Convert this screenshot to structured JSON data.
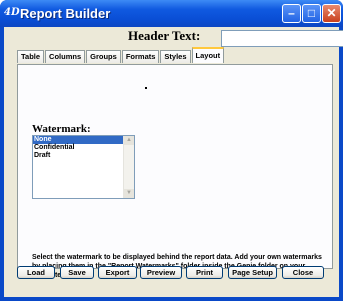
{
  "window": {
    "title": "Report Builder",
    "icon_text": "4D",
    "controls": {
      "minimize": "–",
      "maximize": "□",
      "close": "✕"
    }
  },
  "header": {
    "label": "Header Text:",
    "value": ""
  },
  "tabs": [
    {
      "label": "Table",
      "active": false
    },
    {
      "label": "Columns",
      "active": false
    },
    {
      "label": "Groups",
      "active": false
    },
    {
      "label": "Formats",
      "active": false
    },
    {
      "label": "Styles",
      "active": false
    },
    {
      "label": "Layout",
      "active": true
    }
  ],
  "watermark": {
    "label": "Watermark:",
    "options": [
      "None",
      "Confidential",
      "Draft"
    ],
    "selected": "None",
    "scroll_up": "▲",
    "scroll_down": "▼"
  },
  "help_text": "Select the watermark to be displayed behind the report data. Add your own watermarks by placing them in the \"Report Watermarks\" folder inside the Genie folder on your computer.",
  "buttons": {
    "load": "Load",
    "save": "Save",
    "export": "Export",
    "preview": "Preview",
    "print": "Print",
    "page_setup": "Page Setup",
    "close": "Close"
  }
}
